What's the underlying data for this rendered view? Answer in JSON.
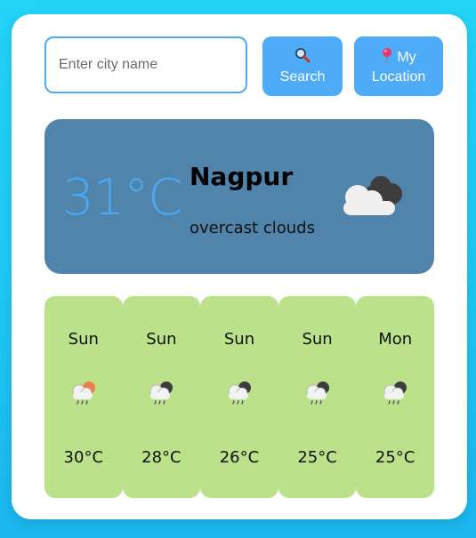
{
  "search": {
    "placeholder": "Enter city name",
    "button_label": "Search",
    "button_icon": "search-icon"
  },
  "location_button": {
    "line1": "My",
    "line2": "Location",
    "icon": "pushpin-icon"
  },
  "current": {
    "temperature": "31°C",
    "city": "Nagpur",
    "description": "overcast clouds",
    "icon": "overcast-clouds-icon"
  },
  "forecast": [
    {
      "day": "Sun",
      "temp": "30°C",
      "icon": "sun-rain-cloud-icon"
    },
    {
      "day": "Sun",
      "temp": "28°C",
      "icon": "rain-cloud-icon"
    },
    {
      "day": "Sun",
      "temp": "26°C",
      "icon": "rain-cloud-icon"
    },
    {
      "day": "Sun",
      "temp": "25°C",
      "icon": "rain-cloud-icon"
    },
    {
      "day": "Mon",
      "temp": "25°C",
      "icon": "rain-cloud-icon"
    }
  ],
  "colors": {
    "background": "#22cdf6",
    "accent": "#4dabf7",
    "current_card": "#5084ab",
    "forecast_card": "#bbe28a",
    "temperature_text": "#4aa8f2"
  }
}
